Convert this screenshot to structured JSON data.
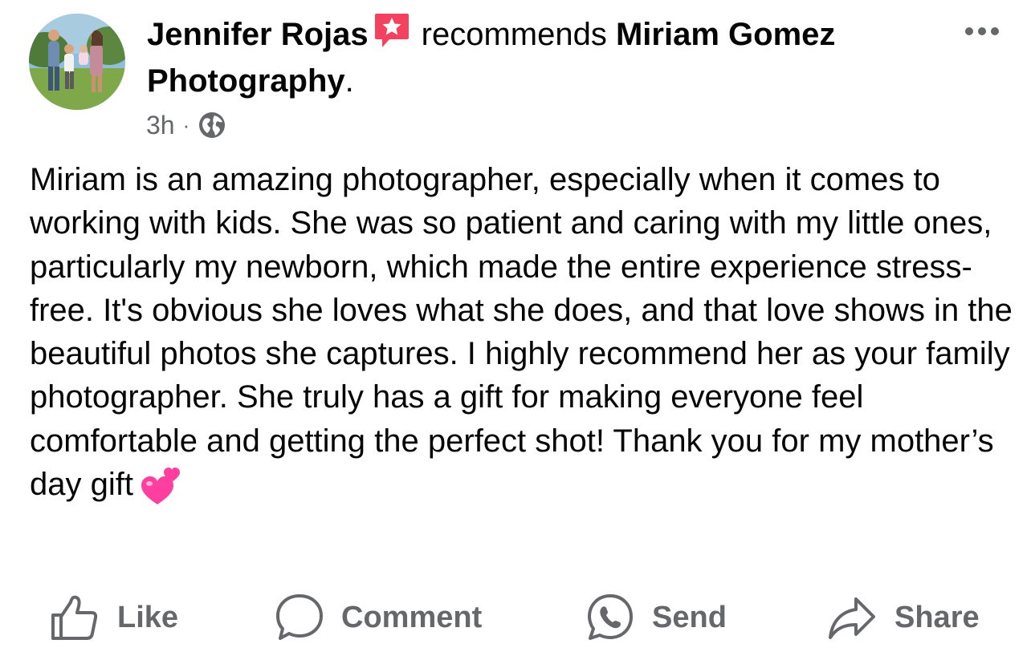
{
  "post": {
    "author": "Jennifer Rojas",
    "verb": "recommends",
    "page": "Miriam Gomez Photography",
    "period": ".",
    "time": "3h",
    "separator": "·",
    "body": "Miriam is an amazing photographer, especially when it comes to working with kids. She was so patient and caring with my little ones, particularly my newborn, which made the entire experience stress-free. It's obvious she loves what she does, and that love shows in the beautiful photos she captures. I highly recommend her as your family photographer. She truly has a gift for making everyone feel comfortable and getting the perfect shot! Thank you for my mother’s day gift"
  },
  "icons": {
    "recommend": "recommend-badge-icon",
    "audience": "globe-icon",
    "more": "more-options-icon",
    "emoji": "two-hearts-icon"
  },
  "actions": {
    "like": "Like",
    "comment": "Comment",
    "send": "Send",
    "share": "Share"
  },
  "colors": {
    "text": "#050505",
    "secondary": "#65676b",
    "badge": "#f3425f"
  }
}
